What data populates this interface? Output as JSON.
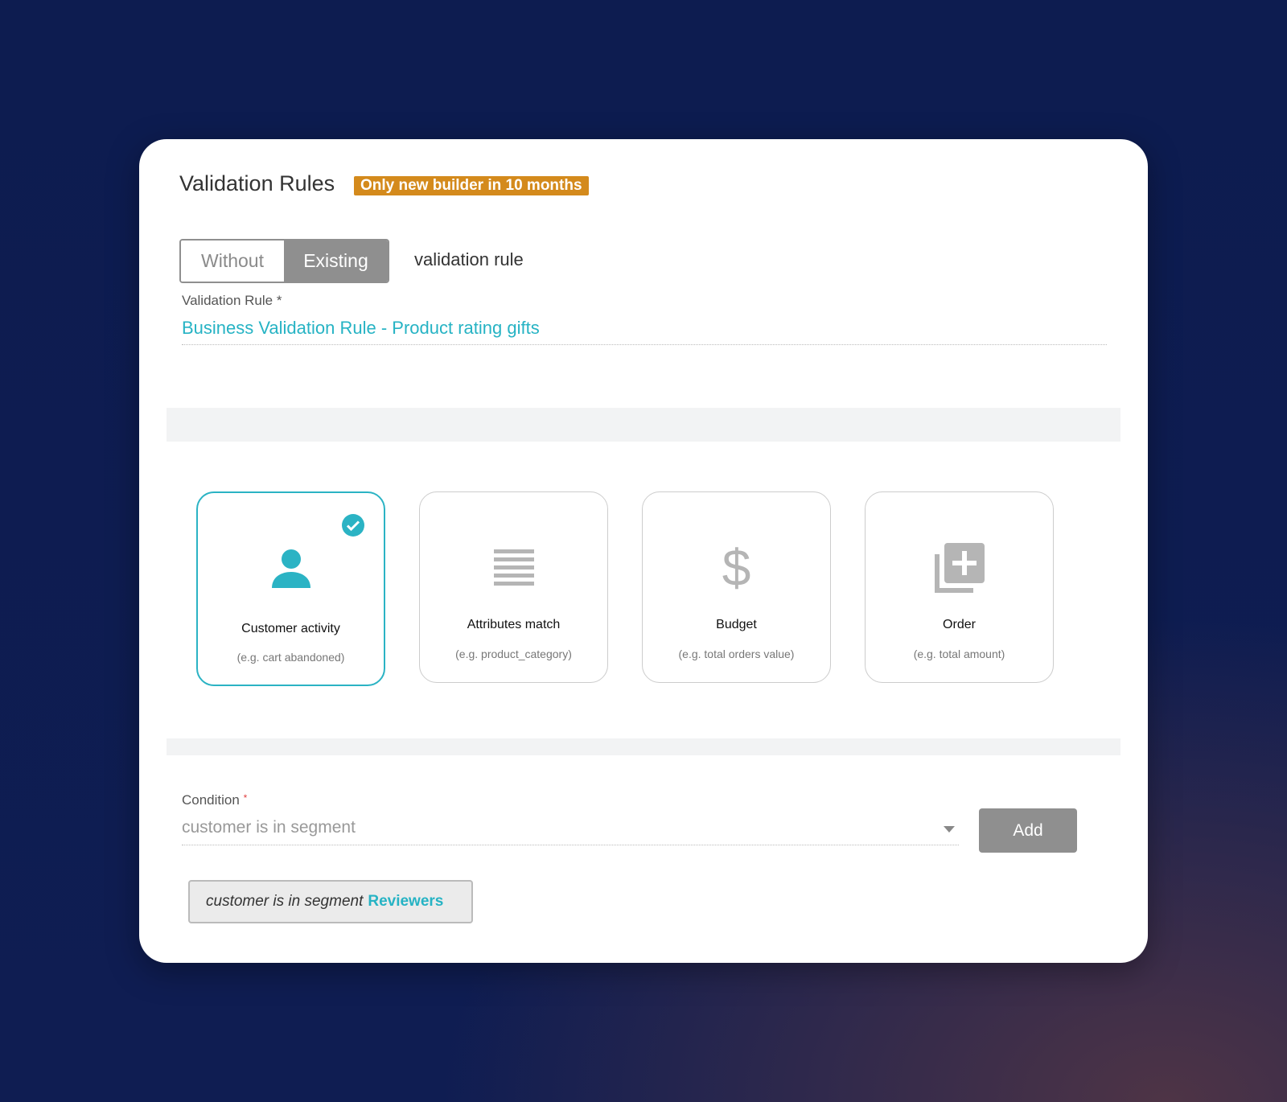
{
  "header": {
    "title": "Validation Rules",
    "badge": "Only new builder in 10 months"
  },
  "toggle": {
    "options": [
      "Without",
      "Existing"
    ],
    "selected": "Existing",
    "suffix": "validation rule"
  },
  "validation_rule": {
    "label": "Validation Rule",
    "required_mark": "*",
    "value": "Business Validation Rule - Product rating gifts"
  },
  "options": [
    {
      "name": "Customer activity",
      "hint": "(e.g. cart abandoned)",
      "icon": "person-icon",
      "selected": true
    },
    {
      "name": "Attributes match",
      "hint": "(e.g. product_category)",
      "icon": "list-icon",
      "selected": false
    },
    {
      "name": "Budget",
      "hint": "(e.g. total orders value)",
      "icon": "dollar-icon",
      "selected": false
    },
    {
      "name": "Order",
      "hint": "(e.g. total amount)",
      "icon": "add-to-library-icon",
      "selected": false
    }
  ],
  "condition": {
    "label": "Condition",
    "required_mark": "*",
    "value": "customer is in segment",
    "add_label": "Add"
  },
  "chip": {
    "text": "customer is in segment",
    "segment": "Reviewers"
  },
  "colors": {
    "accent": "#26b3c4",
    "badge": "#d48a1c",
    "button": "#8f8f8f"
  }
}
